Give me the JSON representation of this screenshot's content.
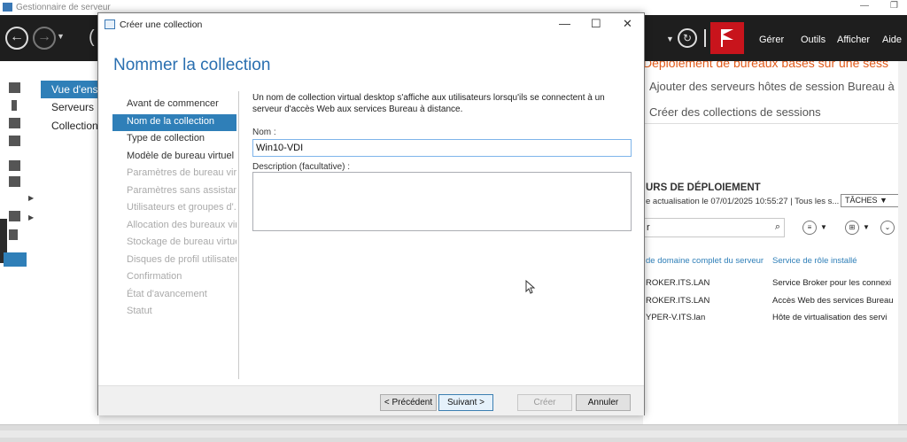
{
  "app": {
    "title": "Gestionnaire de serveur"
  },
  "toolbar": {
    "menus": [
      "Gérer",
      "Outils",
      "Afficher",
      "Aide"
    ]
  },
  "nav": {
    "items": [
      "Vue d'ens",
      "Serveurs",
      "Collections"
    ]
  },
  "background": {
    "deployment_title": "Déploiement de bureaux basés sur une sess",
    "tasks": [
      "Ajouter des serveurs hôtes de session Bureau à",
      "Créer des collections de sessions"
    ],
    "section_title": "URS DE DÉPLOIEMENT",
    "section_sub": "e actualisation le 07/01/2025 10:55:27 | Tous les s...",
    "tasks_button": "TÂCHES",
    "search_placeholder": "r",
    "columns": [
      "de domaine complet du serveur",
      "Service de rôle installé"
    ],
    "rows": [
      [
        "ROKER.ITS.LAN",
        "Service Broker pour les connexi"
      ],
      [
        "ROKER.ITS.LAN",
        "Accès Web des services Bureau"
      ],
      [
        "YPER-V.ITS.lan",
        "Hôte de virtualisation des servi"
      ]
    ]
  },
  "dialog": {
    "title": "Créer une collection",
    "heading": "Nommer la collection",
    "steps": [
      {
        "label": "Avant de commencer",
        "state": "normal"
      },
      {
        "label": "Nom de la collection",
        "state": "active"
      },
      {
        "label": "Type de collection",
        "state": "normal"
      },
      {
        "label": "Modèle de bureau virtuel",
        "state": "normal"
      },
      {
        "label": "Paramètres de bureau virt...",
        "state": "disabled"
      },
      {
        "label": "Paramètres sans assistance",
        "state": "disabled"
      },
      {
        "label": "Utilisateurs et groupes d'...",
        "state": "disabled"
      },
      {
        "label": "Allocation des bureaux vir...",
        "state": "disabled"
      },
      {
        "label": "Stockage de bureau virtuel",
        "state": "disabled"
      },
      {
        "label": "Disques de profil utilisateur",
        "state": "disabled"
      },
      {
        "label": "Confirmation",
        "state": "disabled"
      },
      {
        "label": "État d'avancement",
        "state": "disabled"
      },
      {
        "label": "Statut",
        "state": "disabled"
      }
    ],
    "description": "Un nom de collection virtual desktop s'affiche aux utilisateurs lorsqu'ils se connectent à un serveur d'accès Web aux services Bureau à distance.",
    "name_label": "Nom :",
    "name_value": "Win10-VDI",
    "description_label": "Description (facultative) :",
    "description_value": "",
    "buttons": {
      "previous": "< Précédent",
      "next": "Suivant >",
      "create": "Créer",
      "cancel": "Annuler"
    }
  },
  "colors": {
    "accent": "#2f7fb8",
    "heading": "#2a6fb0",
    "flag": "#c8141c",
    "deployment": "#e05a1a"
  }
}
